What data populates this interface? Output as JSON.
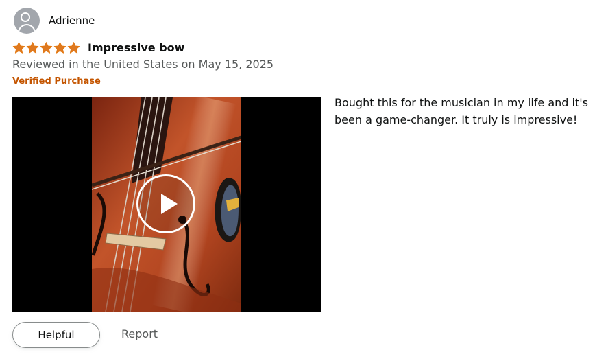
{
  "review": {
    "reviewer_name": "Adrienne",
    "rating": 5,
    "rating_max": 5,
    "title": "Impressive bow",
    "date_line": "Reviewed in the United States on May 15, 2025",
    "verified_label": "Verified Purchase",
    "body": "Bought this for the musician in my life and it's been a game-changer. It truly is impressive!",
    "actions": {
      "helpful_label": "Helpful",
      "report_label": "Report"
    },
    "media": {
      "type": "video",
      "play_icon": "play-icon"
    }
  },
  "colors": {
    "star": "#f3a847",
    "star_fill": "#de7921",
    "verified": "#c45500",
    "secondary_text": "#565959",
    "avatar_bg": "#a2a6ac",
    "video_bg": "#000000"
  }
}
